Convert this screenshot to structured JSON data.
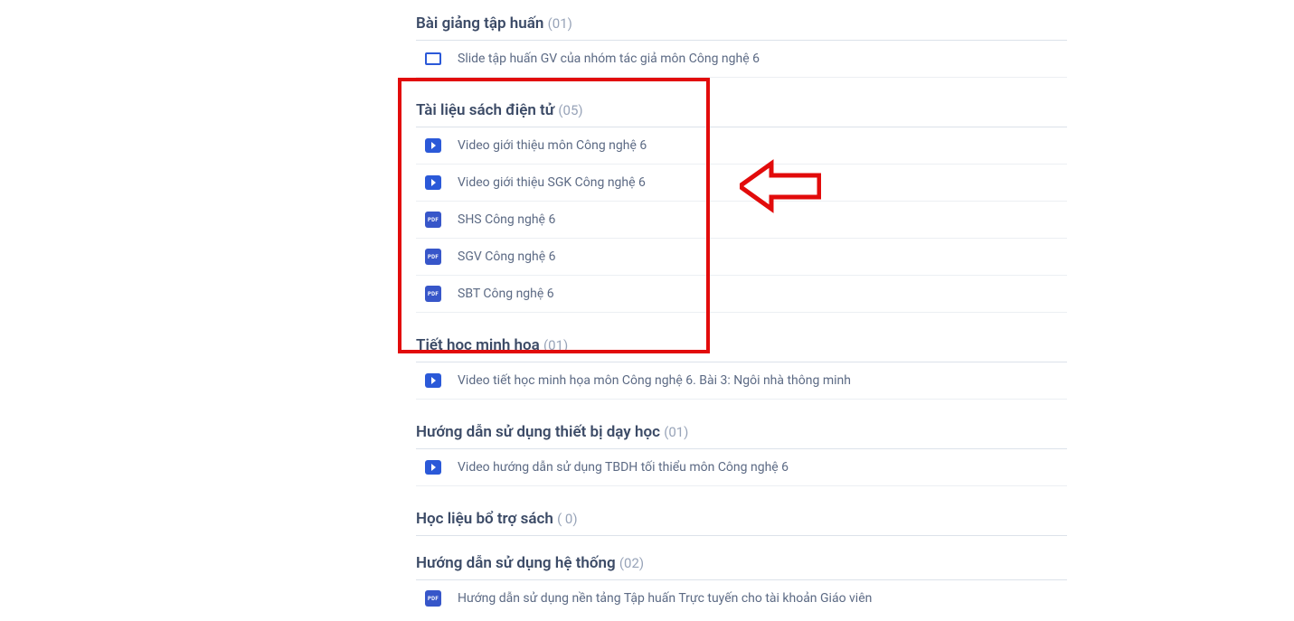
{
  "sections": [
    {
      "title": "Bài giảng tập huấn",
      "count": "(01)",
      "items": [
        {
          "icon": "slide",
          "label": "Slide tập huấn GV của nhóm tác giả môn Công nghệ 6"
        }
      ]
    },
    {
      "title": "Tài liệu sách điện tử",
      "count": "(05)",
      "items": [
        {
          "icon": "video",
          "label": "Video giới thiệu môn Công nghệ 6"
        },
        {
          "icon": "video",
          "label": "Video giới thiệu SGK Công nghệ 6"
        },
        {
          "icon": "pdf",
          "label": "SHS Công nghệ 6"
        },
        {
          "icon": "pdf",
          "label": "SGV Công nghệ 6"
        },
        {
          "icon": "pdf",
          "label": "SBT Công nghệ 6"
        }
      ]
    },
    {
      "title": "Tiết học minh họa",
      "count": "(01)",
      "items": [
        {
          "icon": "video",
          "label": "Video tiết học minh họa môn Công nghệ 6. Bài 3: Ngôi nhà thông minh"
        }
      ]
    },
    {
      "title": "Hướng dẫn sử dụng thiết bị dạy học",
      "count": "(01)",
      "items": [
        {
          "icon": "video",
          "label": "Video hướng dẫn sử dụng TBDH tối thiểu môn Công nghệ 6"
        }
      ]
    },
    {
      "title": "Học liệu bổ trợ sách",
      "count": "( 0)",
      "items": []
    },
    {
      "title": "Hướng dẫn sử dụng hệ thống",
      "count": "(02)",
      "items": [
        {
          "icon": "pdf",
          "label": "Hướng dẫn sử dụng nền tảng Tập huấn Trực tuyến cho tài khoản Giáo viên"
        }
      ]
    }
  ],
  "icon_text": {
    "pdf": "PDF"
  }
}
